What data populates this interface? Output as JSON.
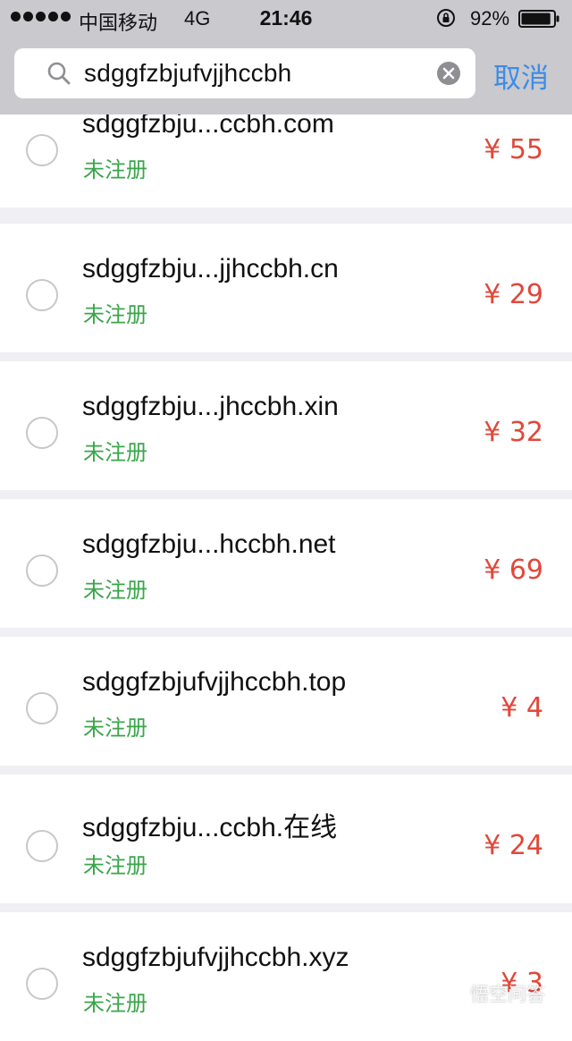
{
  "status_bar": {
    "carrier": "中国移动",
    "network": "4G",
    "time": "21:46",
    "battery": "92%",
    "battery_level": 0.92
  },
  "search": {
    "query": "sdggfzbjufvjjhccbh",
    "cancel_label": "取消"
  },
  "domains": [
    {
      "name": "sdggfzbju...ccbh.com",
      "status": "未注册",
      "price": "¥ 55"
    },
    {
      "name": "sdggfzbju...jjhccbh.cn",
      "status": "未注册",
      "price": "¥ 29"
    },
    {
      "name": "sdggfzbju...jhccbh.xin",
      "status": "未注册",
      "price": "¥ 32"
    },
    {
      "name": "sdggfzbju...hccbh.net",
      "status": "未注册",
      "price": "¥ 69"
    },
    {
      "name": "sdggfzbjufvjjhccbh.top",
      "status": "未注册",
      "price": "¥ 4"
    },
    {
      "name": "sdggfzbju...ccbh.在线",
      "status": "未注册",
      "price": "¥ 24"
    },
    {
      "name": "sdggfzbjufvjjhccbh.xyz",
      "status": "未注册",
      "price": "¥ 3"
    }
  ],
  "watermark": "悟空问答",
  "colors": {
    "accent_blue": "#3d8ce6",
    "status_green": "#3aa64a",
    "price_red": "#e0483a"
  }
}
